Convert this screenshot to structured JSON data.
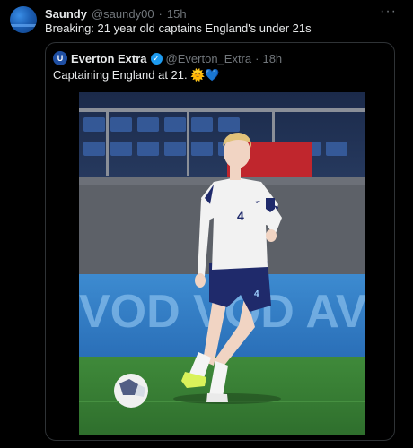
{
  "tweet": {
    "author_name": "Saundy",
    "author_handle": "@saundy00",
    "separator": "·",
    "time": "15h",
    "text": "Breaking: 21 year old captains England's under 21s",
    "more_icon": "more-horizontal-icon"
  },
  "quoted": {
    "author_name": "Everton Extra",
    "author_handle": "@Everton_Extra",
    "separator": "·",
    "time": "18h",
    "text": "Captaining England at 21. ",
    "emoji": "🌞💙",
    "verified_icon": "verified-badge-icon",
    "photo": {
      "board_text": "VOD  VOD AVOD",
      "shirt_number": "4"
    }
  },
  "colors": {
    "background": "#000000",
    "text": "#e7e9ea",
    "muted": "#71767b",
    "border": "#2f3336",
    "verified": "#1d9bf0"
  }
}
